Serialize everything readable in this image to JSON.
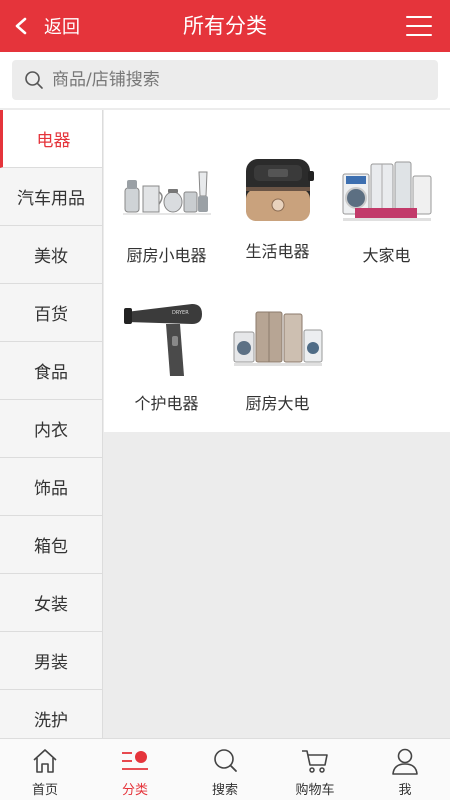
{
  "header": {
    "back_label": "返回",
    "title": "所有分类"
  },
  "search": {
    "placeholder": "商品/店铺搜索"
  },
  "categories": [
    {
      "label": "电器"
    },
    {
      "label": "汽车用品"
    },
    {
      "label": "美妆"
    },
    {
      "label": "百货"
    },
    {
      "label": "食品"
    },
    {
      "label": "内衣"
    },
    {
      "label": "饰品"
    },
    {
      "label": "箱包"
    },
    {
      "label": "女装"
    },
    {
      "label": "男装"
    },
    {
      "label": "洗护"
    }
  ],
  "products": [
    {
      "label": "厨房小电器",
      "icon": "kitchen-appliances"
    },
    {
      "label": "生活电器",
      "icon": "rice-cooker"
    },
    {
      "label": "大家电",
      "icon": "large-appliances"
    },
    {
      "label": "个护电器",
      "icon": "hair-dryer"
    },
    {
      "label": "厨房大电",
      "icon": "kitchen-large-appliances"
    }
  ],
  "tabbar": [
    {
      "label": "首页",
      "icon": "home-icon"
    },
    {
      "label": "分类",
      "icon": "category-icon"
    },
    {
      "label": "搜索",
      "icon": "search-icon"
    },
    {
      "label": "购物车",
      "icon": "cart-icon"
    },
    {
      "label": "我",
      "icon": "user-icon"
    }
  ],
  "colors": {
    "brand": "#e5343b",
    "background": "#ececec"
  }
}
